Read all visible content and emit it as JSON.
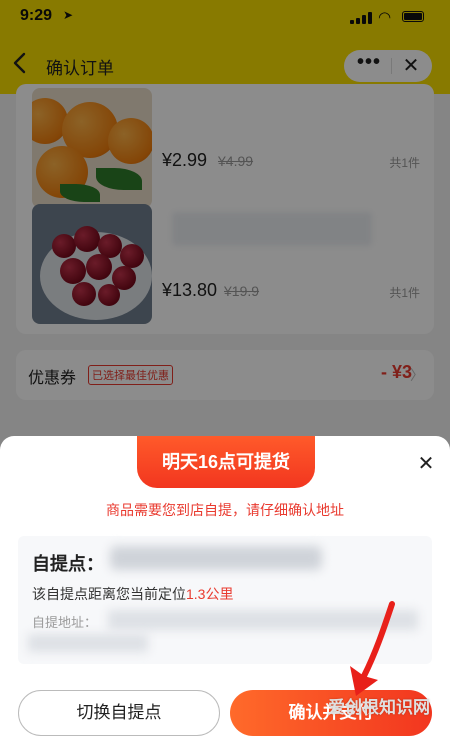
{
  "status_bar": {
    "time": "9:29"
  },
  "header": {
    "title": "确认订单"
  },
  "products": [
    {
      "price": "¥2.99",
      "original_price": "¥4.99",
      "quantity": "共1件"
    },
    {
      "price": "¥13.80",
      "original_price": "¥19.9",
      "quantity": "共1件"
    }
  ],
  "coupon": {
    "label": "优惠券",
    "tag": "已选择最佳优惠",
    "value": "- ¥3"
  },
  "sheet": {
    "banner": "明天16点可提货",
    "notice": "商品需要您到店自提，请仔细确认地址",
    "pickup_label": "自提点：",
    "distance_prefix": "该自提点距离您当前定位",
    "distance_value": "1.3公里",
    "address_label": "自提地址：",
    "switch_button": "切换自提点",
    "confirm_button": "确认并支付"
  },
  "watermark": "爱创根知识网",
  "colors": {
    "header_yellow": "#f7df00",
    "accent_red": "#e93a2f"
  }
}
